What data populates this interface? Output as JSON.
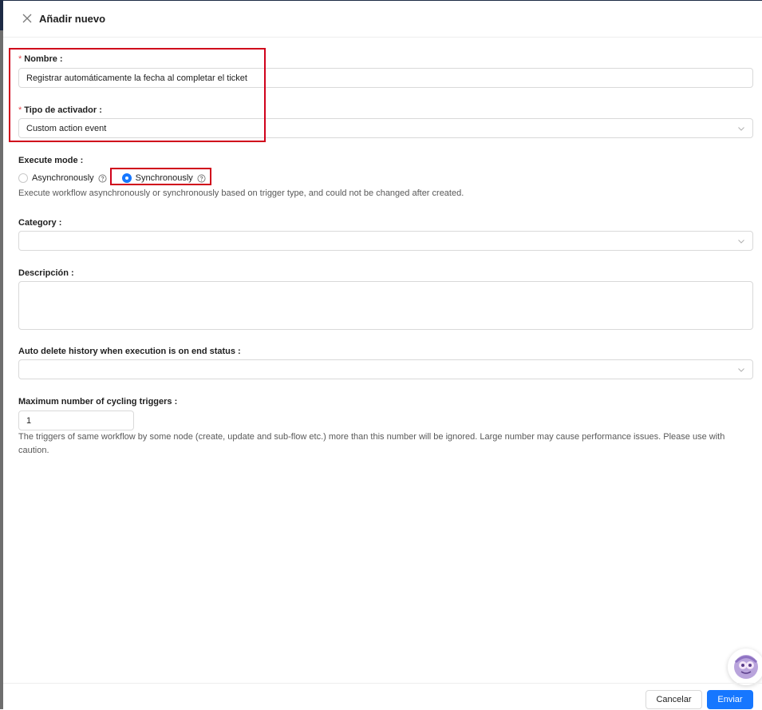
{
  "header": {
    "title": "Añadir nuevo"
  },
  "form": {
    "name": {
      "label": "Nombre",
      "value": "Registrar automáticamente la fecha al completar el ticket"
    },
    "trigger_type": {
      "label": "Tipo de activador",
      "value": "Custom action event"
    },
    "execute_mode": {
      "label": "Execute mode",
      "options": [
        {
          "label": "Asynchronously",
          "selected": false
        },
        {
          "label": "Synchronously",
          "selected": true
        }
      ],
      "hint": "Execute workflow asynchronously or synchronously based on trigger type, and could not be changed after created."
    },
    "category": {
      "label": "Category",
      "value": ""
    },
    "description": {
      "label": "Descripción",
      "value": ""
    },
    "auto_delete": {
      "label": "Auto delete history when execution is on end status",
      "value": ""
    },
    "max_cycling": {
      "label": "Maximum number of cycling triggers",
      "value": "1",
      "hint": "The triggers of same workflow by some node (create, update and sub-flow etc.) more than this number will be ignored. Large number may cause performance issues. Please use with caution."
    }
  },
  "footer": {
    "cancel_label": "Cancelar",
    "submit_label": "Enviar"
  },
  "colors": {
    "primary": "#1677ff",
    "required": "#e5484d",
    "highlight": "#d0021b"
  },
  "icons": {
    "close": "close-icon",
    "help": "question-circle-icon",
    "chevron": "chevron-down-icon",
    "assistant": "assistant-avatar-icon"
  }
}
